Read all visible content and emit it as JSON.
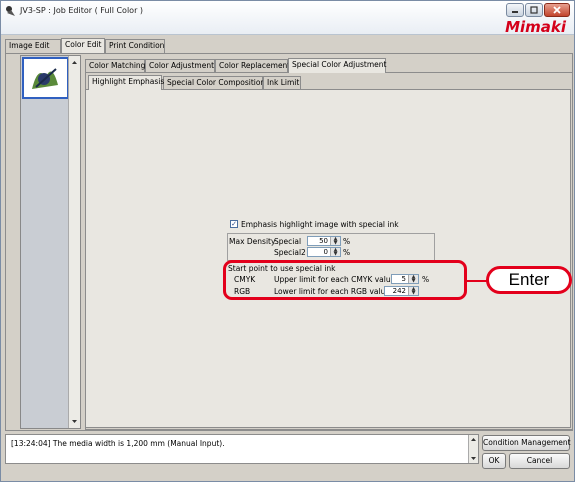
{
  "window": {
    "title": "JV3-SP : Job Editor ( Full Color )",
    "brand": "Mimaki"
  },
  "main_tabs": [
    {
      "label": "Image Edit",
      "active": false
    },
    {
      "label": "Color Edit",
      "active": true
    },
    {
      "label": "Print Condition",
      "active": false
    }
  ],
  "sub_tabs": [
    {
      "label": "Color Matching",
      "active": false
    },
    {
      "label": "Color Adjustment",
      "active": false
    },
    {
      "label": "Color Replacement",
      "active": false
    },
    {
      "label": "Special Color Adjustment",
      "active": true
    }
  ],
  "inner_tabs": [
    {
      "label": "Highlight Emphasis",
      "active": true
    },
    {
      "label": "Special Color Composition",
      "active": false
    },
    {
      "label": "Ink Limit",
      "active": false
    }
  ],
  "emphasis": {
    "checkbox_label": "Emphasis highlight image with special ink",
    "checked": true
  },
  "max_density": {
    "label": "Max Density",
    "special_label": "Special",
    "special_value": "50",
    "special2_label": "Special2",
    "special2_value": "0",
    "unit": "%"
  },
  "start_point": {
    "title": "Start point to use special ink",
    "cmyk_label": "CMYK",
    "cmyk_desc": "Upper limit for each CMYK value",
    "cmyk_value": "5",
    "cmyk_unit": "%",
    "rgb_label": "RGB",
    "rgb_desc": "Lower limit for each RGB value",
    "rgb_value": "242"
  },
  "callout": {
    "label": "Enter"
  },
  "status": {
    "message": "[13:24:04] The media width is 1,200 mm (Manual Input)."
  },
  "buttons": {
    "condition_management": "Condition Management",
    "ok": "OK",
    "cancel": "Cancel"
  },
  "colors": {
    "highlight": "#e3001b",
    "brand": "#d4001a"
  }
}
